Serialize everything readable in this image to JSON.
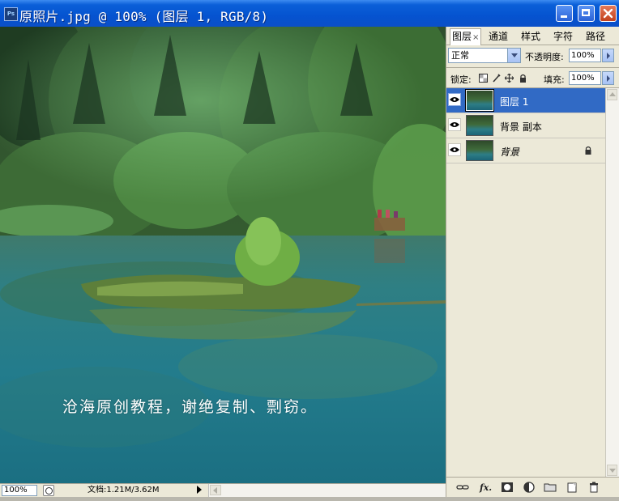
{
  "window": {
    "title": "原照片.jpg @ 100% (图层 1, RGB/8)",
    "app_icon": "photoshop-icon",
    "buttons": [
      "minimize-icon",
      "maximize-icon",
      "close-icon"
    ]
  },
  "canvas": {
    "watermark": "沧海原创教程，谢绝复制、剽窃。",
    "image_description_icon": "lake-forest-photo"
  },
  "status_bar": {
    "zoom": "100%",
    "doc_info": "文档:1.21M/3.62M"
  },
  "layers_panel": {
    "tabs": [
      {
        "label": "图层",
        "active": true
      },
      {
        "label": "通道",
        "active": false
      },
      {
        "label": "样式",
        "active": false
      },
      {
        "label": "字符",
        "active": false
      },
      {
        "label": "路径",
        "active": false
      }
    ],
    "tab_close": "×",
    "blend_mode": "正常",
    "opacity_label": "不透明度:",
    "opacity_value": "100%",
    "lock_label": "锁定:",
    "fill_label": "填充:",
    "fill_value": "100%",
    "layers": [
      {
        "name": "图层 1",
        "selected": true,
        "visible": true,
        "locked": false
      },
      {
        "name": "背景 副本",
        "selected": false,
        "visible": true,
        "locked": false
      },
      {
        "name": "背景",
        "selected": false,
        "visible": true,
        "locked": true
      }
    ],
    "bottom_icons": [
      "link-layers-icon",
      "fx-icon",
      "mask-icon",
      "adjustment-layer-icon",
      "new-group-icon",
      "new-layer-icon",
      "trash-icon"
    ]
  },
  "colors": {
    "titlebar": "#0553d0",
    "selection": "#316ac5",
    "panel_bg": "#ece9d8"
  }
}
